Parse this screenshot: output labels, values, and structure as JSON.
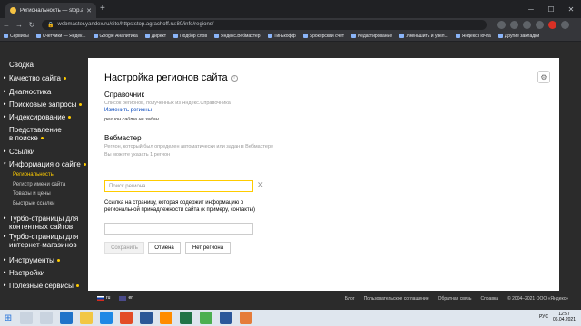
{
  "browser": {
    "tab_title": "Региональность — stop.agrach...",
    "url": "webmaster.yandex.ru/site/https:stop.agrachoff.ru:80/info/regions/",
    "bookmarks": [
      "Сервисы",
      "Счётчики — Яндек...",
      "Google Аналитика",
      "Директ",
      "Подбор слов",
      "Яндекс.Вебмастер",
      "Тинькофф",
      "Брокерский счет",
      "Редактирование",
      "Уменьшить и увел...",
      "Яндекс.Почта",
      "Другие закладки"
    ]
  },
  "sidebar": {
    "items": [
      {
        "label": "Сводка",
        "arrow": "",
        "dot": false
      },
      {
        "label": "Качество сайта",
        "arrow": "▸",
        "dot": true
      },
      {
        "label": "Диагностика",
        "arrow": "▸",
        "dot": false
      },
      {
        "label": "Поисковые запросы",
        "arrow": "▸",
        "dot": true
      },
      {
        "label": "Индексирование",
        "arrow": "▸",
        "dot": true
      },
      {
        "label": "Представление",
        "label2": "в поиске",
        "arrow": "",
        "dot": true
      },
      {
        "label": "Ссылки",
        "arrow": "▸",
        "dot": false
      },
      {
        "label": "Информация о сайте",
        "arrow": "▾",
        "dot": true
      }
    ],
    "subitems": [
      "Региональность",
      "Регистр имени сайта",
      "Товары и цены",
      "Быстрые ссылки"
    ],
    "items_after": [
      {
        "label": "Турбо-страницы для",
        "label2": "контентных сайтов",
        "arrow": "▸",
        "dot": false
      },
      {
        "label": "Турбо-страницы для",
        "label2": "интернет-магазинов",
        "arrow": "▸",
        "dot": false
      },
      {
        "label": "Инструменты",
        "arrow": "▸",
        "dot": true
      },
      {
        "label": "Настройки",
        "arrow": "▸",
        "dot": false
      },
      {
        "label": "Полезные сервисы",
        "arrow": "▸",
        "dot": true
      }
    ]
  },
  "main": {
    "title": "Настройка регионов сайта",
    "directory": {
      "title": "Справочник",
      "desc": "Список регионов, полученных из Яндекс.Справочника",
      "link": "Изменить регионы",
      "status": "регион сайта не задан"
    },
    "webmaster": {
      "title": "Вебмастер",
      "desc1": "Регион, который был определен автоматически или задан в Вебмастере",
      "desc2": "Вы можете указать 1 регион",
      "search_placeholder": "Поиск региона",
      "link_label": "Ссылка на страницу, которая содержит информацию о региональной принадлежности сайта (к примеру, контакты)"
    },
    "buttons": {
      "save": "Сохранить",
      "cancel": "Отмена",
      "no_region": "Нет региона"
    }
  },
  "footer": {
    "lang_ru": "ru",
    "lang_en": "en",
    "links": [
      "Блог",
      "Пользовательское соглашение",
      "Обратная связь",
      "Справка",
      "© 2004–2021 ООО «Яндекс»"
    ]
  },
  "taskbar": {
    "lang": "РУС",
    "time": "12:57",
    "date": "06.04.2021"
  }
}
